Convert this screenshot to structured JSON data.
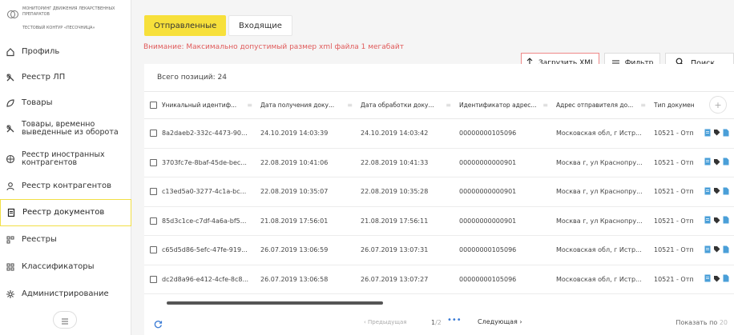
{
  "logo": {
    "line1": "МОНИТОРИНГ ДВИЖЕНИЯ ЛЕКАРСТВЕННЫХ ПРЕПАРАТОВ",
    "line2": "ТЕСТОВЫЙ КОНТУР «ПЕСОЧНИЦА»"
  },
  "sidebar": {
    "items": [
      {
        "label": "Профиль",
        "icon": "home-icon"
      },
      {
        "label": "Реестр ЛП",
        "icon": "pills-icon"
      },
      {
        "label": "Товары",
        "icon": "leaf-icon"
      },
      {
        "label": "Товары, временно выведенные из оборота",
        "icon": "pills-off-icon"
      },
      {
        "label": "Реестр иностранных контрагентов",
        "icon": "globe-icon"
      },
      {
        "label": "Реестр контрагентов",
        "icon": "person-icon"
      },
      {
        "label": "Реестр документов",
        "icon": "document-icon"
      },
      {
        "label": "Реестры",
        "icon": "registries-icon"
      },
      {
        "label": "Классификаторы",
        "icon": "grid-icon"
      },
      {
        "label": "Администрирование",
        "icon": "gear-icon"
      }
    ],
    "active_index": 6,
    "collapse_icon": "menu-icon"
  },
  "tabs": {
    "sent": "Отправленные",
    "incoming": "Входящие"
  },
  "warning": "Внимание: Максимально допустимый размер xml файла 1 мегабайт",
  "toolbar": {
    "upload_label": "Загрузить XML",
    "filter_label": "Фильтр",
    "search_label": "Поиск"
  },
  "total_label": "Всего позиций: 24",
  "table": {
    "columns": [
      "Уникальный идентиф...",
      "Дата получения доку...",
      "Дата обработки доку...",
      "Идентификатор адрес...",
      "Адрес отправителя до...",
      "Тип докумен"
    ],
    "rows": [
      [
        "8a2daeb2-332c-4473-90...",
        "24.10.2019 14:03:39",
        "24.10.2019 14:03:42",
        "00000000105096",
        "Московская обл, г Истр...",
        "10521 - Отп"
      ],
      [
        "3703fc7e-8baf-45de-bec...",
        "22.08.2019 10:41:06",
        "22.08.2019 10:41:33",
        "00000000000901",
        "Москва г, ул Краснопру...",
        "10521 - Отп"
      ],
      [
        "c13ed5a0-3277-4c1a-bc...",
        "22.08.2019 10:35:07",
        "22.08.2019 10:35:28",
        "00000000000901",
        "Москва г, ул Краснопру...",
        "10521 - Отп"
      ],
      [
        "85d3c1ce-c7df-4a6a-bf5...",
        "21.08.2019 17:56:01",
        "21.08.2019 17:56:11",
        "00000000000901",
        "Москва г, ул Краснопру...",
        "10521 - Отп"
      ],
      [
        "c65d5d86-5efc-47fe-919...",
        "26.07.2019 13:06:59",
        "26.07.2019 13:07:31",
        "00000000105096",
        "Московская обл, г Истр...",
        "10521 - Отп"
      ],
      [
        "dc2d8a96-e412-4cfe-8c8...",
        "26.07.2019 13:06:58",
        "26.07.2019 13:07:27",
        "00000000105096",
        "Московская обл, г Истр...",
        "10521 - Отп"
      ]
    ]
  },
  "pagination": {
    "prev": "‹ Предыдущая",
    "current": "1",
    "total": "/2",
    "dots": "•••",
    "next": "Следующая ›",
    "page_size_label": "Показать по",
    "page_size": "20"
  },
  "colors": {
    "accent": "#f7e03b",
    "warning": "#e05a5a",
    "doc_icon": "#4a9fd8"
  }
}
